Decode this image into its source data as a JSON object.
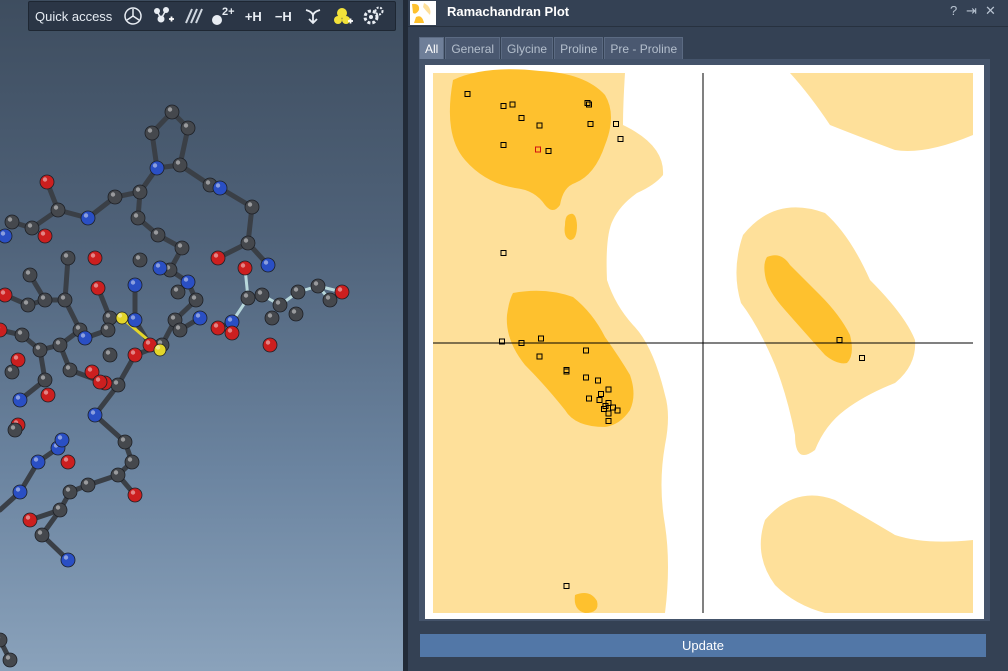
{
  "quick_access": {
    "label": "Quick access",
    "buttons": [
      {
        "icon": "clean-geometry-icon"
      },
      {
        "icon": "add-fragment-icon"
      },
      {
        "icon": "bond-order-icon"
      },
      {
        "icon": "charge-icon",
        "text": "2+"
      },
      {
        "icon": "add-hydrogens-icon",
        "text": "+H"
      },
      {
        "icon": "remove-hydrogens-icon",
        "text": "−H"
      },
      {
        "icon": "minimize-icon"
      },
      {
        "icon": "add-ligand-icon"
      },
      {
        "icon": "settings-icon"
      }
    ]
  },
  "panel": {
    "title": "Ramachandran Plot",
    "help": "?",
    "pin": "⇥",
    "close": "✕",
    "tabs": [
      "All",
      "General",
      "Glycine",
      "Proline",
      "Pre - Proline"
    ],
    "active_tab": "All",
    "update_label": "Update"
  },
  "colors": {
    "favored": "#fec12e",
    "allowed": "#fee09a",
    "background": "#ffffff",
    "residue_point": "#000000",
    "highlight_point": "#d11010",
    "accent": "#5277a7"
  },
  "chart_data": {
    "type": "scatter",
    "title": "",
    "xlabel": "",
    "ylabel": "",
    "xlim": [
      -180,
      180
    ],
    "ylim": [
      -180,
      180
    ],
    "grid": false,
    "legend": "none",
    "x": [
      -157,
      -133,
      -127,
      -121,
      -133,
      -109,
      -110,
      -103,
      -77,
      -76,
      -75,
      -58,
      -55,
      -133,
      -108,
      -134,
      -121,
      -91,
      -91,
      -109,
      -78,
      -78,
      -70,
      -63,
      -68,
      -63,
      -76,
      -69,
      -65,
      -60,
      -66,
      -65,
      -63,
      -57,
      -63,
      -91,
      91,
      106
    ],
    "y": [
      166,
      158,
      159,
      150,
      132,
      145,
      129,
      128,
      160,
      159,
      146,
      146,
      136,
      60,
      3,
      1,
      0,
      -18,
      -19,
      -9,
      -5,
      -23,
      -25,
      -31,
      -34,
      -40,
      -37,
      -38,
      -42,
      -43,
      -44,
      -42,
      -47,
      -45,
      -52,
      -162,
      2,
      -10
    ],
    "flags": [
      "ok",
      "ok",
      "ok",
      "ok",
      "ok",
      "ok",
      "outlier",
      "ok",
      "ok",
      "ok",
      "ok",
      "ok",
      "ok",
      "ok",
      "ok",
      "ok",
      "ok",
      "ok",
      "ok",
      "ok",
      "ok",
      "ok",
      "ok",
      "ok",
      "ok",
      "ok",
      "ok",
      "ok",
      "ok",
      "ok",
      "ok",
      "ok",
      "ok",
      "ok",
      "ok",
      "ok",
      "ok",
      "ok"
    ]
  }
}
